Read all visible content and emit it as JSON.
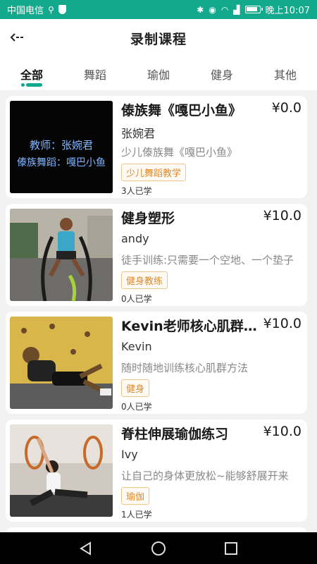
{
  "status_bar": {
    "carrier": "中国电信",
    "time": "晚上10:07"
  },
  "header": {
    "title": "录制课程"
  },
  "tabs": [
    {
      "label": "全部",
      "active": true
    },
    {
      "label": "舞蹈",
      "active": false
    },
    {
      "label": "瑜伽",
      "active": false
    },
    {
      "label": "健身",
      "active": false
    },
    {
      "label": "其他",
      "active": false
    }
  ],
  "thumb1": {
    "line1": "教师：张婉君",
    "line2": "傣族舞蹈：嘎巴小鱼"
  },
  "courses": [
    {
      "title": "傣族舞《嘎巴小鱼》",
      "price": "¥0.0",
      "author": "张婉君",
      "desc": "少儿傣族舞《嘎巴小鱼》",
      "tag": "少儿舞蹈教学",
      "count": "3人已学"
    },
    {
      "title": "健身塑形",
      "price": "¥10.0",
      "author": "andy",
      "desc": "徒手训练:只需要一个空地、一个垫子",
      "tag": "健身教练",
      "count": "0人已学"
    },
    {
      "title": "Kevin老师核心肌群训练",
      "price": "¥10.0",
      "author": "Kevin",
      "desc": "随时随地训练核心肌群方法",
      "tag": "健身",
      "count": "0人已学"
    },
    {
      "title": "脊柱伸展瑜伽练习",
      "price": "¥10.0",
      "author": "Ivy",
      "desc": "让自己的身体更放松~能够舒展开来",
      "tag": "瑜伽",
      "count": "1人已学"
    }
  ],
  "colors": {
    "accent": "#13a98d",
    "tag_text": "#e08a2a",
    "tag_border": "#f2c48e"
  }
}
